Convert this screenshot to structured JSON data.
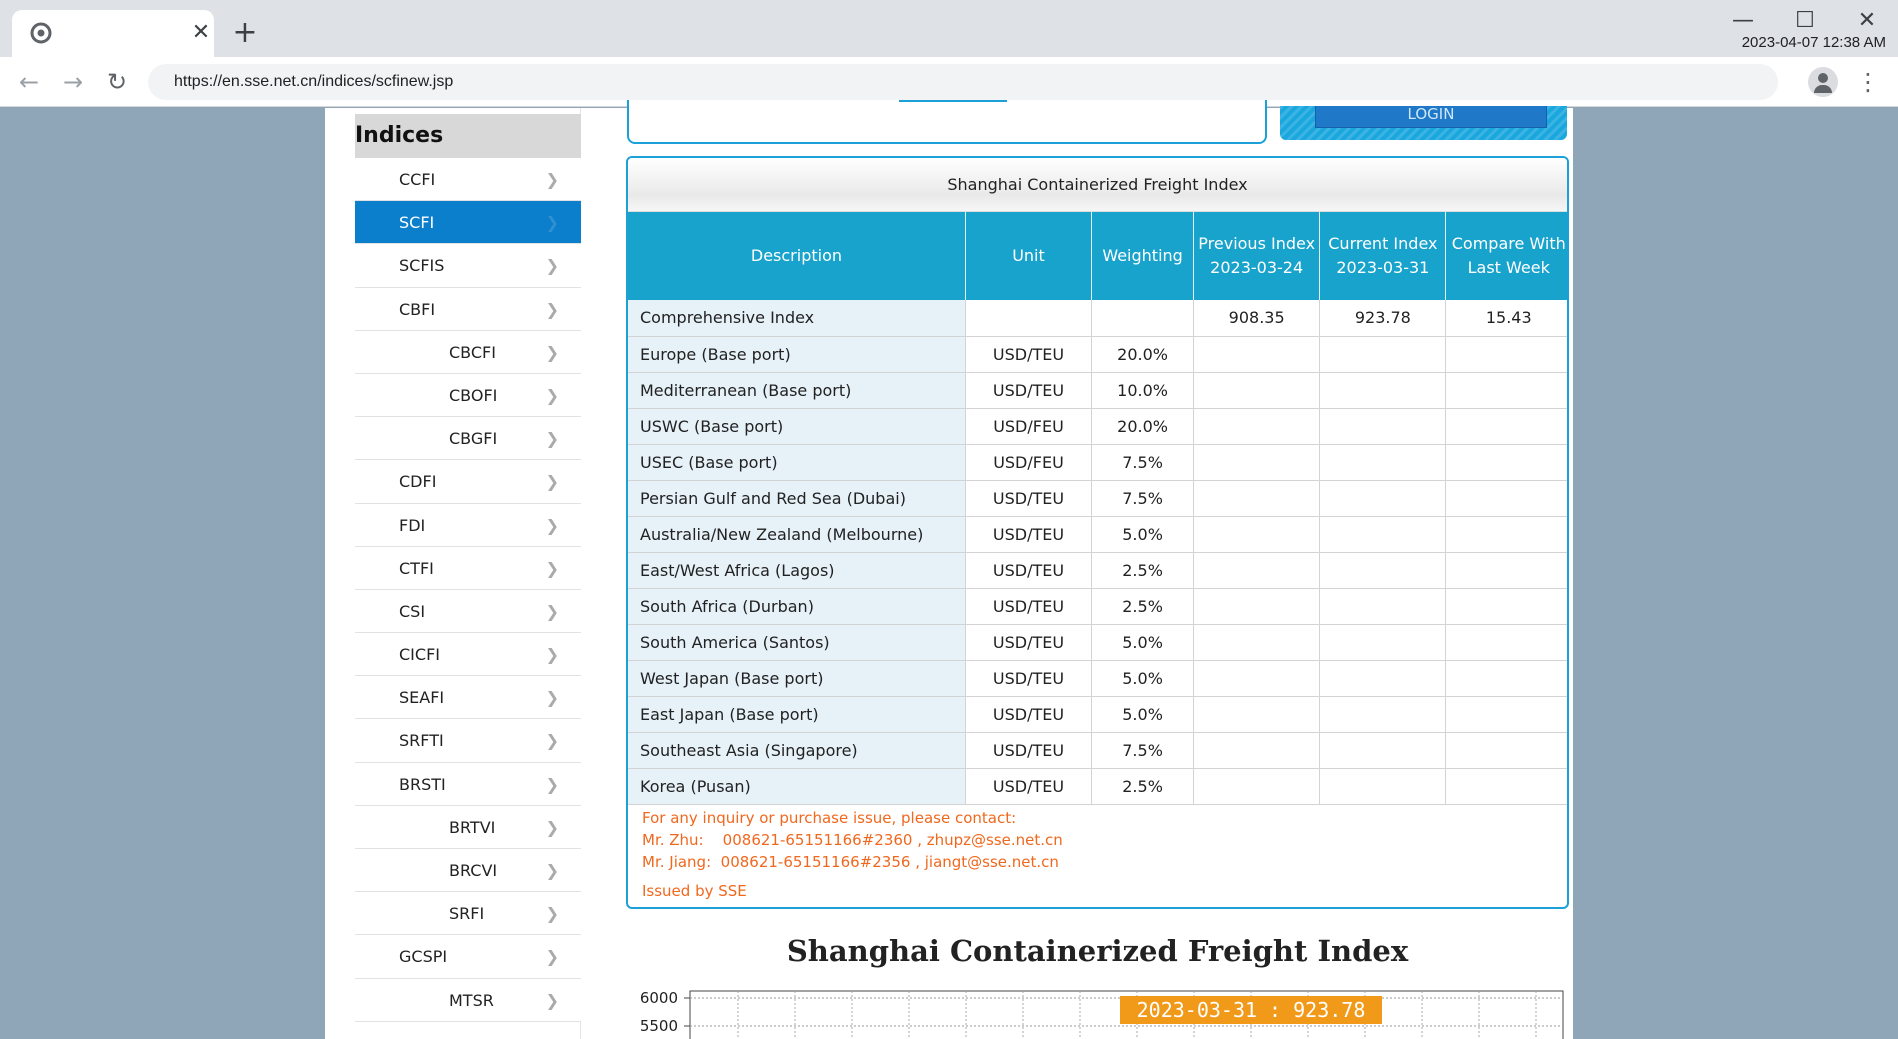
{
  "browser": {
    "url": "https://en.sse.net.cn/indices/scfinew.jsp",
    "clock": "2023-04-07 12:38 AM"
  },
  "sidebar": {
    "title": "Indices",
    "items": [
      {
        "label": "CCFI",
        "level": 1
      },
      {
        "label": "SCFI",
        "level": 1,
        "active": true
      },
      {
        "label": "SCFIS",
        "level": 1
      },
      {
        "label": "CBFI",
        "level": 1
      },
      {
        "label": "CBCFI",
        "level": 2
      },
      {
        "label": "CBOFI",
        "level": 2
      },
      {
        "label": "CBGFI",
        "level": 2
      },
      {
        "label": "CDFI",
        "level": 1
      },
      {
        "label": "FDI",
        "level": 1
      },
      {
        "label": "CTFI",
        "level": 1
      },
      {
        "label": "CSI",
        "level": 1
      },
      {
        "label": "CICFI",
        "level": 1
      },
      {
        "label": "SEAFI",
        "level": 1
      },
      {
        "label": "SRFTI",
        "level": 1
      },
      {
        "label": "BRSTI",
        "level": 1
      },
      {
        "label": "BRTVI",
        "level": 2
      },
      {
        "label": "BRCVI",
        "level": 2
      },
      {
        "label": "SRFI",
        "level": 2
      },
      {
        "label": "GCSPI",
        "level": 1
      },
      {
        "label": "MTSR",
        "level": 2
      }
    ]
  },
  "login": {
    "button_label": "LOGIN"
  },
  "table": {
    "title": "Shanghai Containerized Freight Index",
    "headers": [
      "Description",
      "Unit",
      "Weighting",
      "Previous Index\n2023-03-24",
      "Current Index\n2023-03-31",
      "Compare With\nLast Week"
    ],
    "rows": [
      [
        "Comprehensive Index",
        "",
        "",
        "908.35",
        "923.78",
        "15.43"
      ],
      [
        "Europe (Base port)",
        "USD/TEU",
        "20.0%",
        "",
        "",
        ""
      ],
      [
        "Mediterranean (Base port)",
        "USD/TEU",
        "10.0%",
        "",
        "",
        ""
      ],
      [
        "USWC (Base port)",
        "USD/FEU",
        "20.0%",
        "",
        "",
        ""
      ],
      [
        "USEC (Base port)",
        "USD/FEU",
        "7.5%",
        "",
        "",
        ""
      ],
      [
        "Persian Gulf and Red Sea (Dubai)",
        "USD/TEU",
        "7.5%",
        "",
        "",
        ""
      ],
      [
        "Australia/New Zealand (Melbourne)",
        "USD/TEU",
        "5.0%",
        "",
        "",
        ""
      ],
      [
        "East/West Africa (Lagos)",
        "USD/TEU",
        "2.5%",
        "",
        "",
        ""
      ],
      [
        "South Africa (Durban)",
        "USD/TEU",
        "2.5%",
        "",
        "",
        ""
      ],
      [
        "South America (Santos)",
        "USD/TEU",
        "5.0%",
        "",
        "",
        ""
      ],
      [
        "West Japan (Base port)",
        "USD/TEU",
        "5.0%",
        "",
        "",
        ""
      ],
      [
        "East Japan (Base port)",
        "USD/TEU",
        "5.0%",
        "",
        "",
        ""
      ],
      [
        "Southeast Asia (Singapore)",
        "USD/TEU",
        "7.5%",
        "",
        "",
        ""
      ],
      [
        "Korea (Pusan)",
        "USD/TEU",
        "2.5%",
        "",
        "",
        ""
      ]
    ],
    "contact": {
      "line1": "For any inquiry or purchase issue, please contact:",
      "line2": "Mr. Zhu:    008621-65151166#2360 , zhupz@sse.net.cn",
      "line3": "Mr. Jiang:  008621-65151166#2356 , jiangt@sse.net.cn",
      "issued": "Issued by SSE"
    }
  },
  "chart_data": {
    "type": "line",
    "title": "Shanghai Containerized Freight Index",
    "y_ticks": [
      "6000",
      "5500"
    ],
    "tooltip": "2023-03-31 : 923.78",
    "ylim": [
      5500,
      6000
    ],
    "grid": true,
    "colors": {
      "tooltip_bg": "#f19a1a",
      "tooltip_text": "#ffffff"
    }
  }
}
